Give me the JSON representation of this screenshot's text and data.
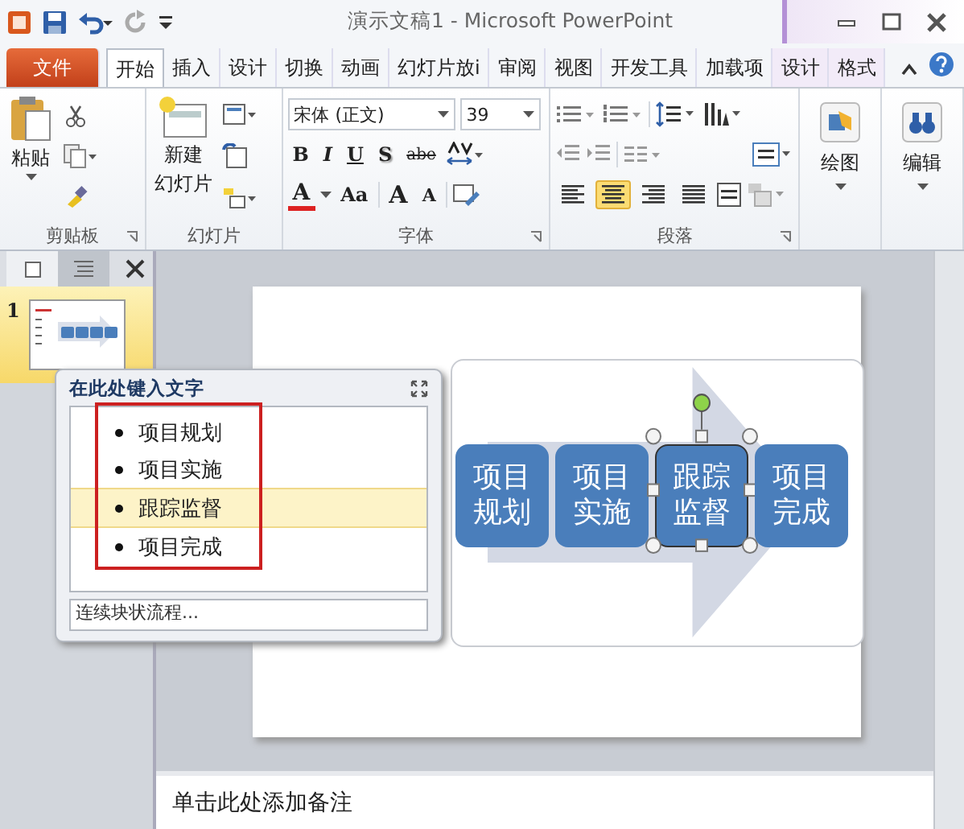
{
  "window": {
    "title": "演示文稿1  -  Microsoft PowerPoint"
  },
  "tabs": [
    {
      "label": "文件",
      "kind": "file",
      "selected": false
    },
    {
      "label": "开始",
      "kind": "normal",
      "selected": true
    },
    {
      "label": "插入",
      "kind": "normal",
      "selected": false
    },
    {
      "label": "设计",
      "kind": "normal",
      "selected": false
    },
    {
      "label": "切换",
      "kind": "normal",
      "selected": false
    },
    {
      "label": "动画",
      "kind": "normal",
      "selected": false
    },
    {
      "label": "幻灯片放i",
      "kind": "normal",
      "selected": false
    },
    {
      "label": "审阅",
      "kind": "normal",
      "selected": false
    },
    {
      "label": "视图",
      "kind": "normal",
      "selected": false
    },
    {
      "label": "开发工具",
      "kind": "normal",
      "selected": false
    },
    {
      "label": "加载项",
      "kind": "normal",
      "selected": false
    },
    {
      "label": "设计",
      "kind": "contextual",
      "selected": false
    },
    {
      "label": "格式",
      "kind": "contextual",
      "selected": false
    }
  ],
  "ribbon": {
    "clipboard": {
      "label": "剪贴板",
      "paste": "粘贴"
    },
    "slides": {
      "label": "幻灯片",
      "new_slide": [
        "新建",
        "幻灯片"
      ]
    },
    "font": {
      "label": "字体",
      "family": "宋体 (正文)",
      "size": "39",
      "styles": [
        "B",
        "I",
        "U",
        "S",
        "abe"
      ],
      "color_letter": "A",
      "case_label": "Aa",
      "grow": "A",
      "shrink": "A"
    },
    "paragraph": {
      "label": "段落",
      "alignments": [
        {
          "selected": false
        },
        {
          "selected": true
        },
        {
          "selected": false
        },
        {
          "selected": false
        }
      ]
    },
    "drawing": {
      "label": "绘图"
    },
    "editing": {
      "label": "编辑"
    }
  },
  "slide_pane": {
    "tabs": [
      {
        "kind": "slides",
        "selected": true
      },
      {
        "kind": "outline",
        "selected": false
      }
    ],
    "thumbnails": [
      {
        "number": "1",
        "selected": true
      }
    ]
  },
  "text_pane": {
    "title": "在此处键入文字",
    "items": [
      {
        "text": "项目规划",
        "selected": false
      },
      {
        "text": "项目实施",
        "selected": false
      },
      {
        "text": "跟踪监督",
        "selected": true
      },
      {
        "text": "项目完成",
        "selected": false
      }
    ],
    "footer": "连续块状流程..."
  },
  "smartart": {
    "nodes": [
      {
        "lines": [
          "项目",
          "规划"
        ],
        "selected": false
      },
      {
        "lines": [
          "项目",
          "实施"
        ],
        "selected": false
      },
      {
        "lines": [
          "跟踪",
          "监督"
        ],
        "selected": true
      },
      {
        "lines": [
          "项目",
          "完成"
        ],
        "selected": false
      }
    ]
  },
  "notes": {
    "placeholder": "单击此处添加备注"
  }
}
